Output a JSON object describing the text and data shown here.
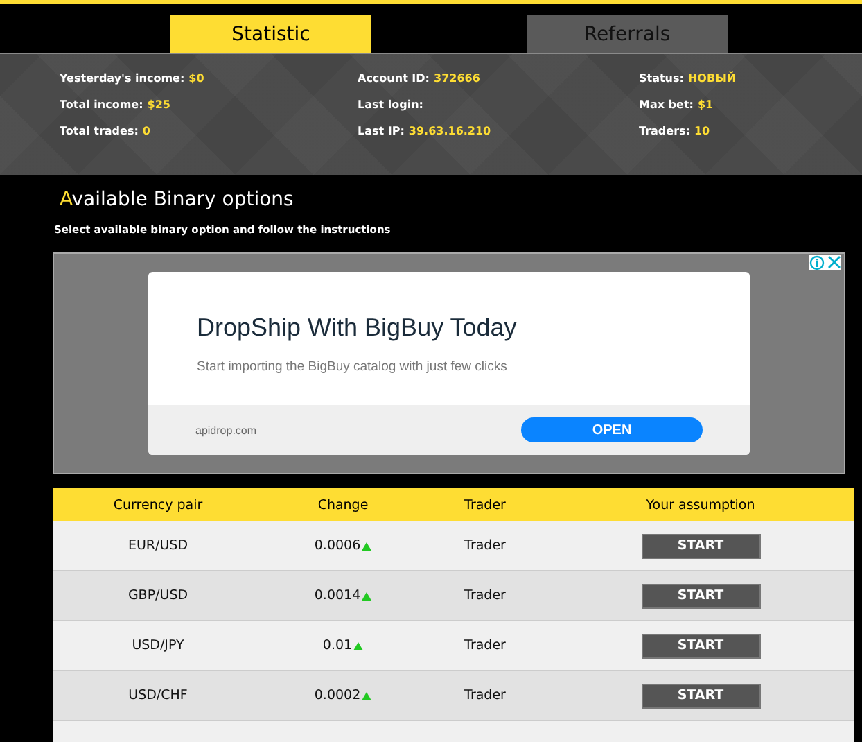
{
  "tabs": [
    {
      "label": "Statistic",
      "selected": true
    },
    {
      "label": "Referrals",
      "selected": false
    }
  ],
  "stats": [
    [
      {
        "label": "Yesterday's income:",
        "value": "$0"
      },
      {
        "label": "Total income:",
        "value": "$25"
      },
      {
        "label": "Total trades:",
        "value": "0"
      }
    ],
    [
      {
        "label": "Account ID:",
        "value": "372666"
      },
      {
        "label": "Last login:"
      },
      {
        "label": "Last IP:",
        "value": "39.63.16.210"
      }
    ],
    [
      {
        "label": "Status:",
        "value": "НОВЫЙ"
      },
      {
        "label": "Max bet:",
        "value": "$1"
      },
      {
        "label": "Traders:",
        "value": "10"
      }
    ]
  ],
  "section": {
    "title": "Available Binary options",
    "subtitle": "Select available binary option and follow the instructions"
  },
  "ad": {
    "headline": "DropShip With BigBuy Today",
    "text": "Start importing the BigBuy catalog with just few clicks",
    "domain": "apidrop.com",
    "button": "OPEN"
  },
  "table": {
    "columns": [
      "Currency pair",
      "Change",
      "Trader",
      "Your assumption"
    ],
    "rows": [
      {
        "pair": "EUR/USD",
        "change": "0.0006",
        "up": true,
        "trader": "Trader",
        "button": "START"
      },
      {
        "pair": "GBP/USD",
        "change": "0.0014",
        "up": true,
        "trader": "Trader",
        "button": "START"
      },
      {
        "pair": "USD/JPY",
        "change": "0.01",
        "up": true,
        "trader": "Trader",
        "button": "START"
      },
      {
        "pair": "USD/CHF",
        "change": "0.0002",
        "up": true,
        "trader": "Trader",
        "button": "START"
      }
    ]
  }
}
